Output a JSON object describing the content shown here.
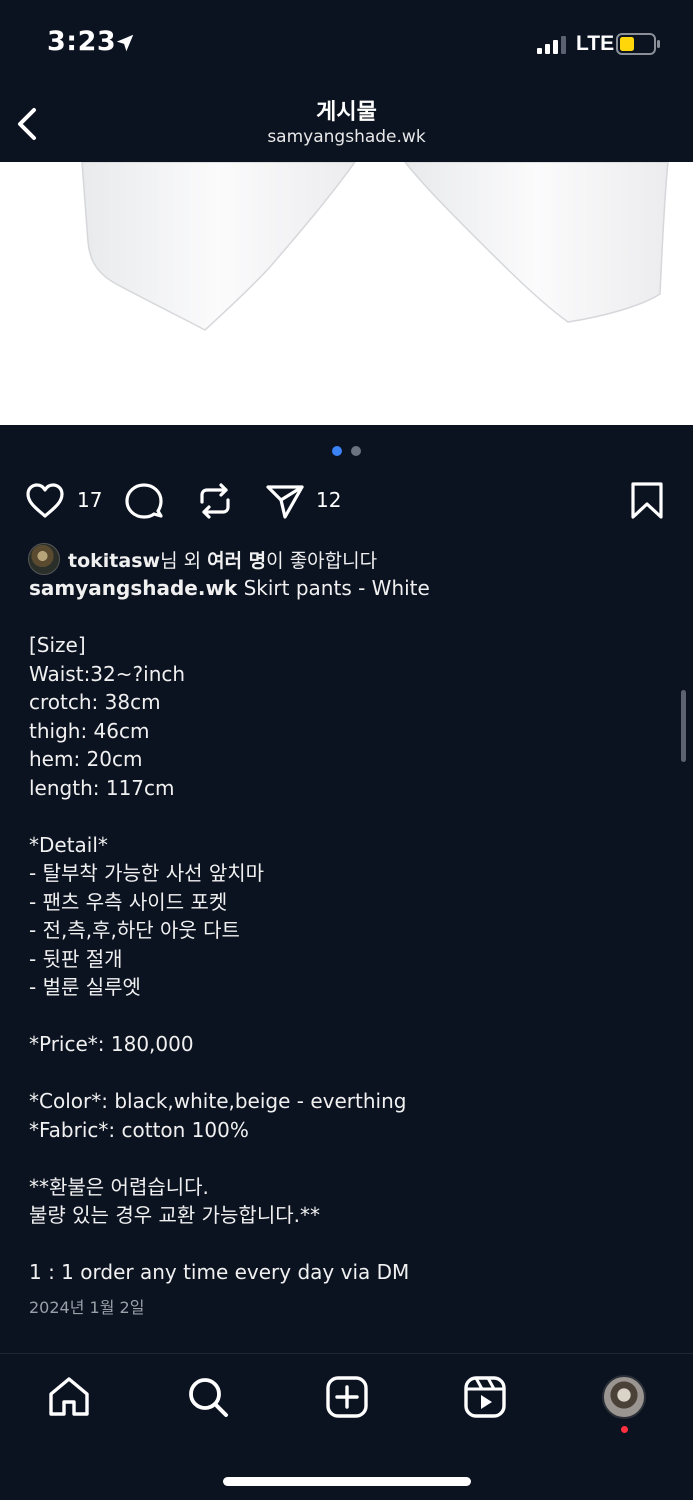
{
  "status_bar": {
    "time": "3:23",
    "network": "LTE",
    "battery_level": 0.45,
    "battery_color": "#ffd60a"
  },
  "header": {
    "title": "게시물",
    "subtitle": "samyangshade.wk",
    "back_icon": "chevron-left-icon"
  },
  "carousel": {
    "total": 2,
    "active_index": 0,
    "active_color": "#3b82f6",
    "inactive_color": "#6b7280"
  },
  "actions": {
    "like_count": "17",
    "share_count": "12",
    "icons": [
      "heart-icon",
      "comment-icon",
      "repost-icon",
      "send-icon",
      "bookmark-icon"
    ]
  },
  "likes": {
    "user": "tokitasw",
    "suffix_1": "님 외 ",
    "others": "여러 명",
    "suffix_2": "이 좋아합니다"
  },
  "caption": {
    "username": "samyangshade.wk",
    "first_line": " Skirt pants - White",
    "lines": [
      "",
      "[Size]",
      "Waist:32~?inch",
      "crotch: 38cm",
      "thigh: 46cm",
      "hem: 20cm",
      "length: 117cm",
      "",
      "*Detail*",
      "- 탈부착 가능한 사선 앞치마",
      "- 팬츠 우측 사이드 포켓",
      "- 전,측,후,하단 아웃 다트",
      "- 뒷판 절개",
      "- 벌룬 실루엣",
      "",
      "*Price*: 180,000",
      "",
      "*Color*: black,white,beige - everthing",
      "*Fabric*: cotton 100%",
      "",
      "**환불은 어렵습니다.",
      "불량 있는 경우 교환 가능합니다.**",
      "",
      "1 : 1 order any time every day via DM"
    ],
    "date": "2024년 1월 2일"
  },
  "tab_bar": {
    "tabs": [
      "home-icon",
      "search-icon",
      "create-icon",
      "reels-icon",
      "profile-avatar"
    ],
    "notification_color": "#ff3040"
  }
}
